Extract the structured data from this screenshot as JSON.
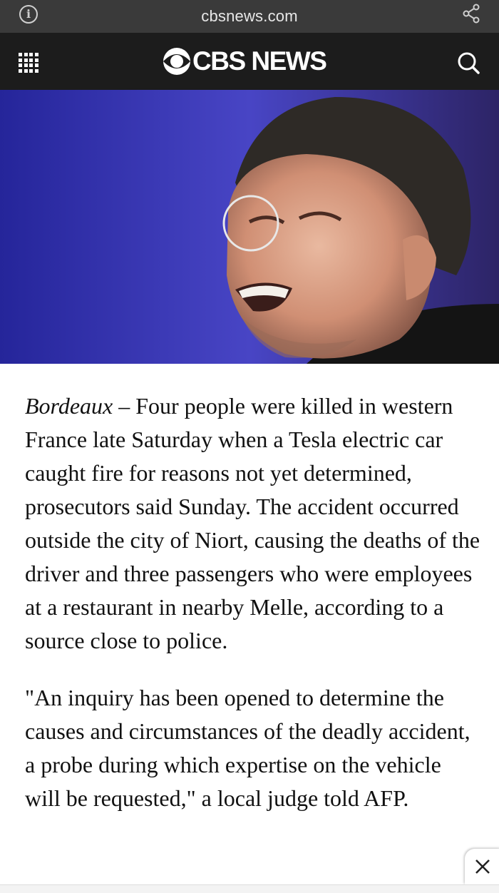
{
  "browser": {
    "url": "cbsnews.com",
    "info_icon": "info-icon",
    "share_icon": "share-icon"
  },
  "header": {
    "logo_text": "CBS NEWS",
    "menu_icon": "grid-menu-icon",
    "search_icon": "search-icon",
    "background": "#1c1c1c"
  },
  "hero": {
    "description_icon": "photo"
  },
  "article": {
    "dateline": "Bordeaux",
    "dash": " – ",
    "paragraph1": "Four people were killed in western France late Saturday when a Tesla electric car caught fire for reasons not yet determined, prosecutors said Sunday. The accident occurred outside the city of Niort, causing the deaths of the driver and three passengers who were employees at a restaurant in nearby Melle, according to a source close to police.",
    "paragraph2": "\"An inquiry has been opened to determine the causes and circumstances of the deadly accident, a probe during which expertise on the vehicle will be requested,\" a local judge told AFP."
  },
  "ad": {
    "close_icon": "close-icon"
  }
}
